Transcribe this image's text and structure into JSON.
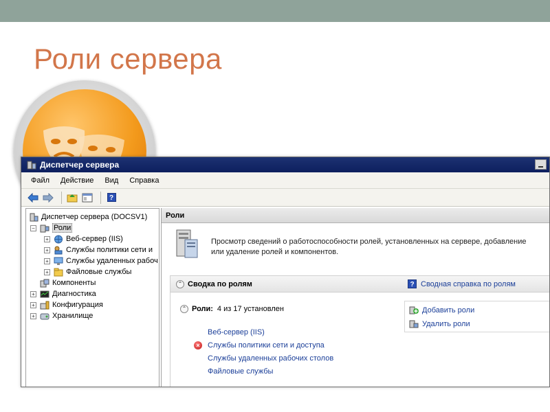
{
  "slide": {
    "title": "Роли сервера"
  },
  "window": {
    "title": "Диспетчер сервера",
    "menu": [
      "Файл",
      "Действие",
      "Вид",
      "Справка"
    ],
    "tree": {
      "root": "Диспетчер сервера (DOCSV1)",
      "roles": "Роли",
      "role_items": [
        "Веб-сервер (IIS)",
        "Службы политики сети и",
        "Службы удаленных рабоч",
        "Файловые службы"
      ],
      "components": "Компоненты",
      "diagnostics": "Диагностика",
      "configuration": "Конфигурация",
      "storage": "Хранилище"
    },
    "right_pane": {
      "header": "Роли",
      "description": "Просмотр сведений о работоспособности ролей, установленных на сервере, добавление или удаление ролей и компонентов.",
      "summary_title": "Сводка по ролям",
      "summary_help": "Сводная справка по ролям",
      "roles_label": "Роли:",
      "roles_count": "4 из 17 установлен",
      "add_roles": "Добавить роли",
      "remove_roles": "Удалить роли",
      "installed_roles": [
        "Веб-сервер (IIS)",
        "Службы политики сети и доступа",
        "Службы удаленных рабочих столов",
        "Файловые службы"
      ]
    }
  }
}
